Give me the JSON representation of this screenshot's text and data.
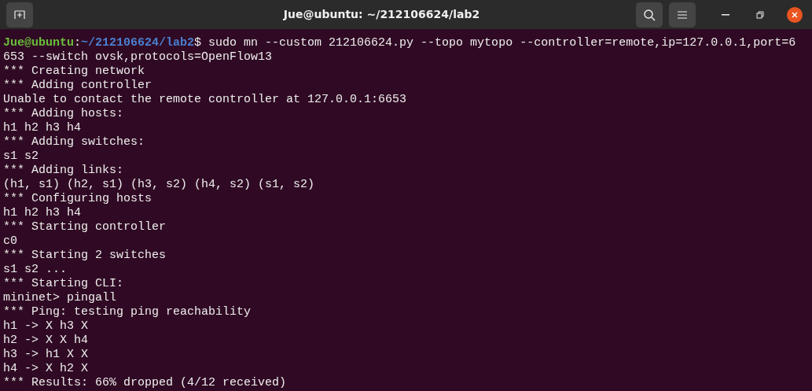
{
  "window": {
    "title": "Jue@ubuntu: ~/212106624/lab2"
  },
  "terminal": {
    "lines": [
      {
        "kind": "prompt",
        "user_host": "Jue@ubuntu",
        "separator": ":",
        "path": "~/212106624/lab2",
        "text": "$ sudo mn --custom 212106624.py --topo mytopo --controller=remote,ip=127.0.0.1,port=6"
      },
      {
        "kind": "output",
        "text": "653 --switch ovsk,protocols=OpenFlow13"
      },
      {
        "kind": "output",
        "text": "*** Creating network"
      },
      {
        "kind": "output",
        "text": "*** Adding controller"
      },
      {
        "kind": "output",
        "text": "Unable to contact the remote controller at 127.0.0.1:6653"
      },
      {
        "kind": "output",
        "text": "*** Adding hosts:"
      },
      {
        "kind": "output",
        "text": "h1 h2 h3 h4"
      },
      {
        "kind": "output",
        "text": "*** Adding switches:"
      },
      {
        "kind": "output",
        "text": "s1 s2"
      },
      {
        "kind": "output",
        "text": "*** Adding links:"
      },
      {
        "kind": "output",
        "text": "(h1, s1) (h2, s1) (h3, s2) (h4, s2) (s1, s2)"
      },
      {
        "kind": "output",
        "text": "*** Configuring hosts"
      },
      {
        "kind": "output",
        "text": "h1 h2 h3 h4"
      },
      {
        "kind": "output",
        "text": "*** Starting controller"
      },
      {
        "kind": "output",
        "text": "c0"
      },
      {
        "kind": "output",
        "text": "*** Starting 2 switches"
      },
      {
        "kind": "output",
        "text": "s1 s2 ..."
      },
      {
        "kind": "output",
        "text": "*** Starting CLI:"
      },
      {
        "kind": "output",
        "text": "mininet> pingall"
      },
      {
        "kind": "output",
        "text": "*** Ping: testing ping reachability"
      },
      {
        "kind": "output",
        "text": "h1 -> X h3 X"
      },
      {
        "kind": "output",
        "text": "h2 -> X X h4"
      },
      {
        "kind": "output",
        "text": "h3 -> h1 X X"
      },
      {
        "kind": "output",
        "text": "h4 -> X h2 X"
      },
      {
        "kind": "output",
        "text": "*** Results: 66% dropped (4/12 received)"
      }
    ]
  }
}
